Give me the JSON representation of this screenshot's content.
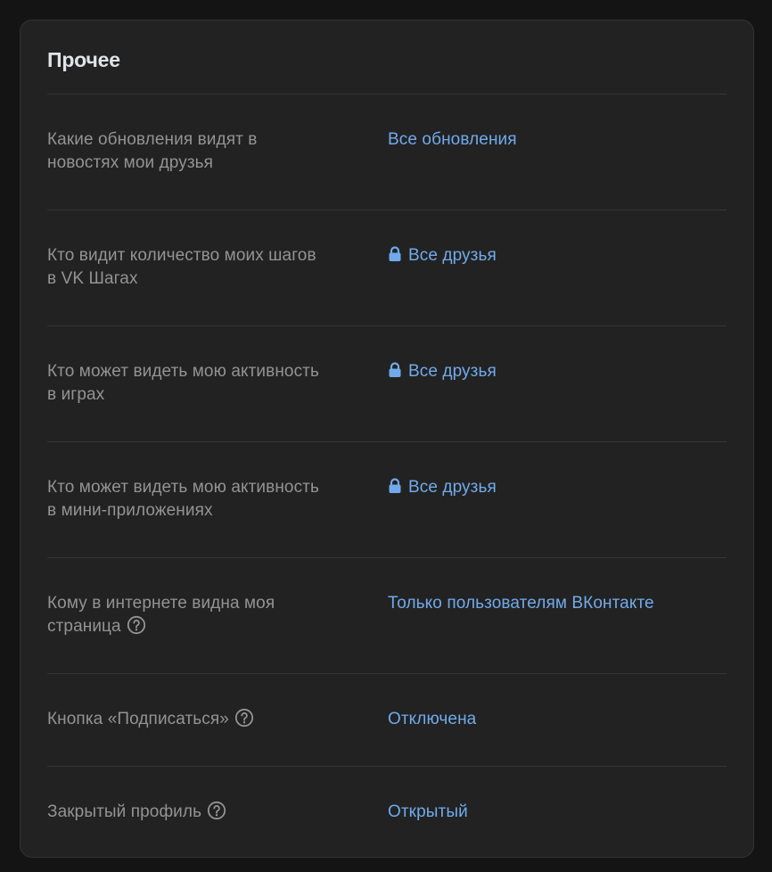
{
  "section": {
    "title": "Прочее"
  },
  "colors": {
    "background": "#141414",
    "card": "#222222",
    "label": "#939393",
    "link": "#71aaeb",
    "title": "#e1e3e6"
  },
  "rows": [
    {
      "label_line1": "Какие обновления видят в",
      "label_line2": "новостях мои друзья",
      "value": "Все обновления",
      "icon": ""
    },
    {
      "label_line1": "Кто видит количество моих шагов",
      "label_line2": "в VK Шагах",
      "value": "Все друзья",
      "icon": "lock-icon"
    },
    {
      "label_line1": "Кто может видеть мою активность",
      "label_line2": "в играх",
      "value": "Все друзья",
      "icon": "lock-icon"
    },
    {
      "label_line1": "Кто может видеть мою активность",
      "label_line2": "в мини-приложениях",
      "value": "Все друзья",
      "icon": "lock-icon"
    },
    {
      "label_line1": "Кому в интернете видна моя",
      "label_line2": "страница",
      "value": "Только пользователям ВКонтакте",
      "icon": "help-icon"
    },
    {
      "label_line1": "Кнопка «Подписаться»",
      "value": "Отключена",
      "icon": "help-icon"
    },
    {
      "label_line1": "Закрытый профиль",
      "value": "Открытый",
      "icon": "help-icon"
    }
  ]
}
